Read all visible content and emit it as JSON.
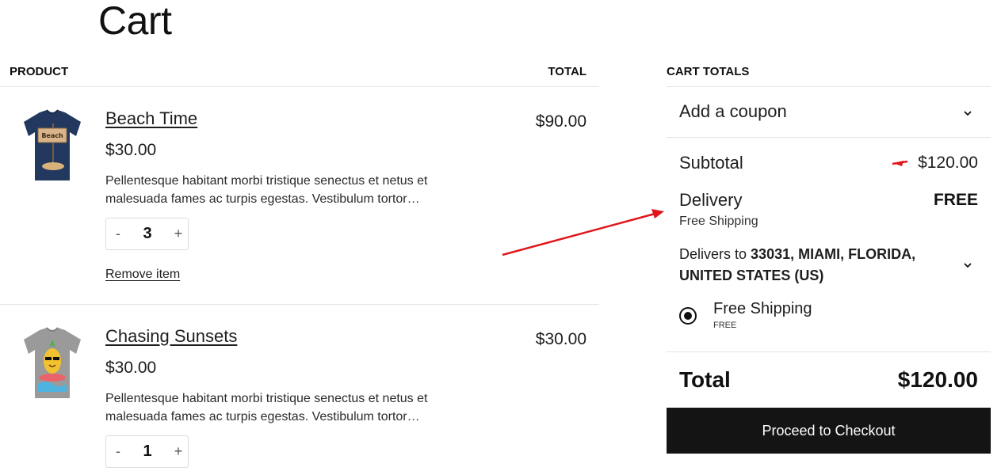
{
  "page": {
    "title": "Cart"
  },
  "table": {
    "col_product": "PRODUCT",
    "col_total": "TOTAL"
  },
  "items": [
    {
      "name": "Beach Time",
      "price": "$30.00",
      "description": "Pellentesque habitant morbi tristique senectus et netus et malesuada fames ac turpis egestas. Vestibulum tortor…",
      "quantity": "3",
      "line_total": "$90.00",
      "remove_label": "Remove item",
      "decrement_label": "-",
      "increment_label": "+",
      "image_icon": "navy-tshirt-beach-sign",
      "shirt_color": "#22385e",
      "sign_text": "Beach"
    },
    {
      "name": "Chasing Sunsets",
      "price": "$30.00",
      "description": "Pellentesque habitant morbi tristique senectus et netus et malesuada fames ac turpis egestas. Vestibulum tortor…",
      "quantity": "1",
      "line_total": "$30.00",
      "decrement_label": "-",
      "increment_label": "+",
      "image_icon": "grey-tshirt-pineapple",
      "shirt_color": "#9a9a9a"
    }
  ],
  "cart_totals": {
    "heading": "CART TOTALS",
    "coupon_label": "Add a coupon",
    "subtotal_label": "Subtotal",
    "subtotal_value": "$120.00",
    "delivery_label": "Delivery",
    "delivery_value": "FREE",
    "delivery_method": "Free Shipping",
    "delivers_to_prefix": "Delivers to",
    "delivers_to_address": "33031, MIAMI, FLORIDA, UNITED STATES (US)",
    "shipping_option_label": "Free Shipping",
    "shipping_option_price": "FREE",
    "total_label": "Total",
    "total_value": "$120.00",
    "checkout_label": "Proceed to Checkout"
  },
  "annotation": {
    "arrow_color": "#e0161b"
  },
  "colors": {
    "button_bg": "#141414",
    "divider": "#e4e4e4"
  }
}
